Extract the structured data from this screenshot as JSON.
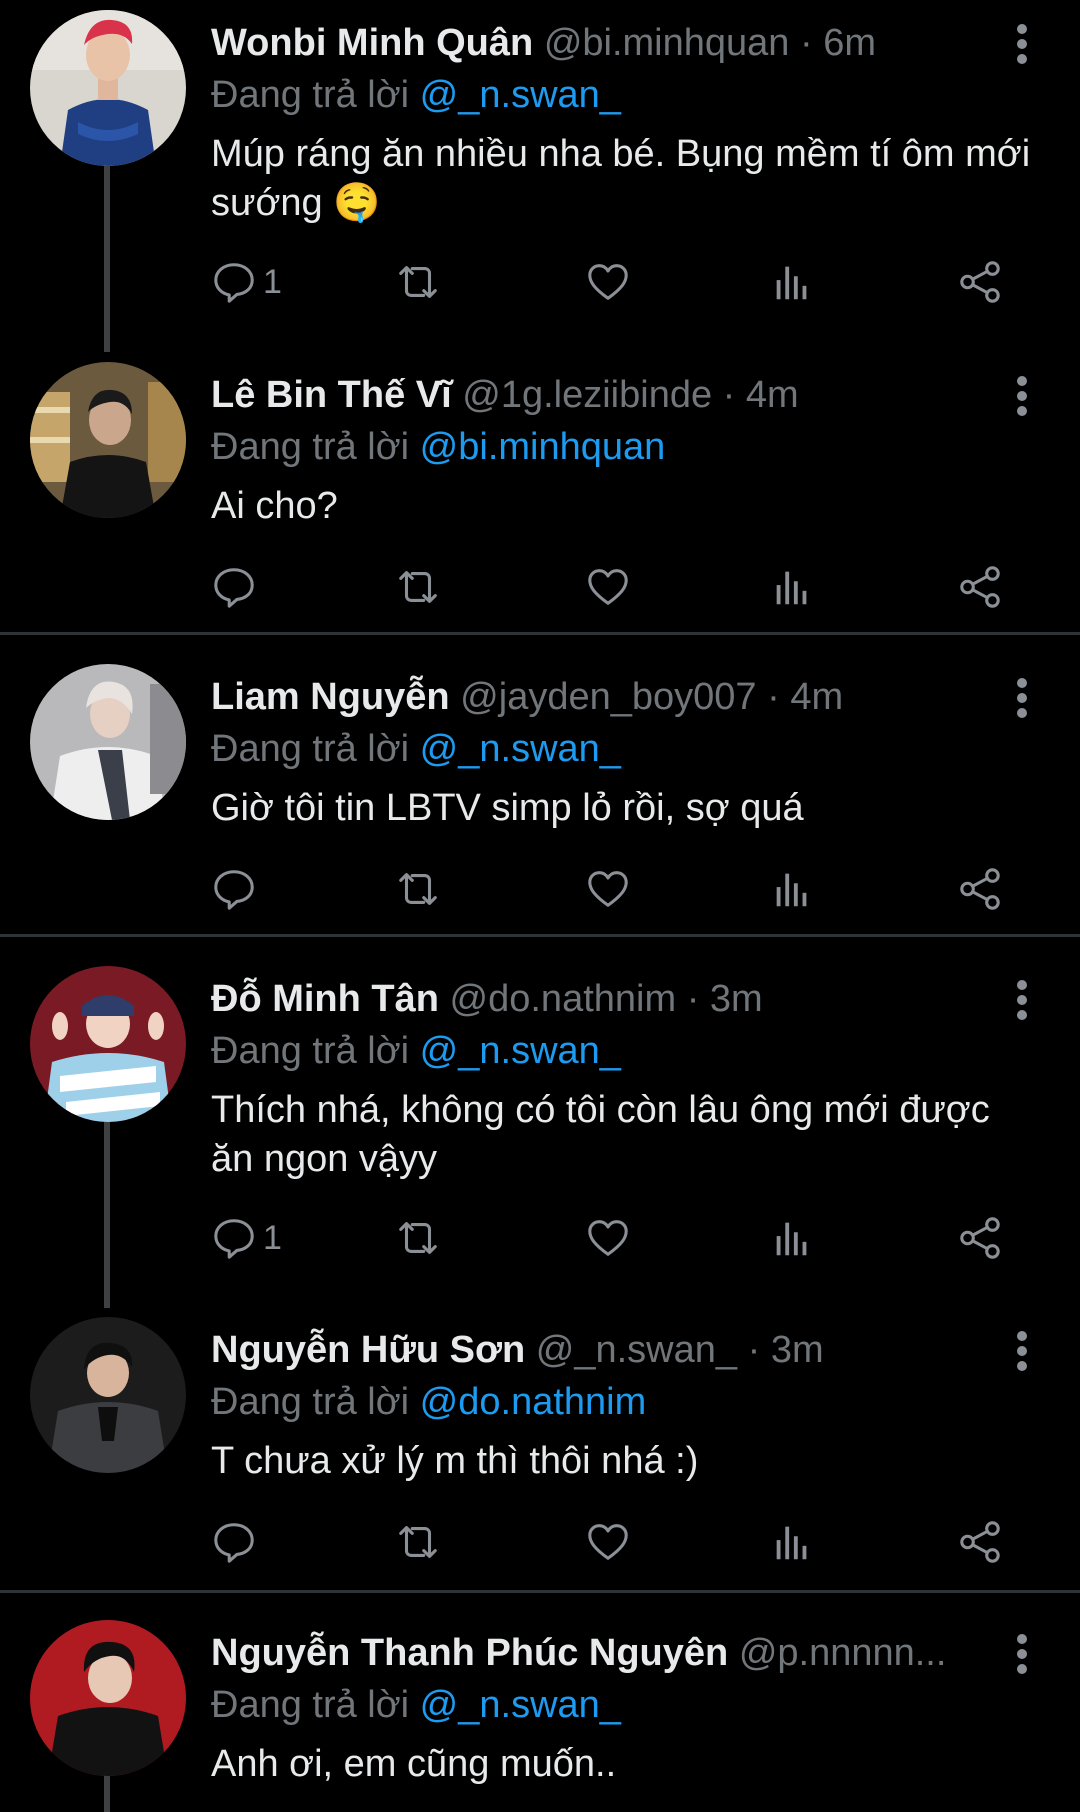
{
  "reply_prefix": "Đang trả lời",
  "colors": {
    "background": "#000000",
    "text": "#e7e9ea",
    "muted": "#71767b",
    "mention": "#1d9bf0",
    "divider": "#2f3336"
  },
  "tweets": [
    {
      "name": "Wonbi Minh Quân",
      "handle": "@bi.minhquan",
      "time": "6m",
      "reply_to": "@_n.swan_",
      "text": "Múp ráng ăn nhiều nha bé. Bụng mềm tí ôm mới sướng 🤤",
      "reply_count": "1"
    },
    {
      "name": "Lê Bin Thế Vĩ",
      "handle": "@1g.leziibinde",
      "time": "4m",
      "reply_to": "@bi.minhquan",
      "text": "Ai cho?",
      "reply_count": ""
    },
    {
      "name": "Liam Nguyễn",
      "handle": "@jayden_boy007",
      "time": "4m",
      "reply_to": "@_n.swan_",
      "text": "Giờ tôi tin LBTV simp lỏ rồi, sợ quá",
      "reply_count": ""
    },
    {
      "name": "Đỗ Minh Tân",
      "handle": "@do.nathnim",
      "time": "3m",
      "reply_to": "@_n.swan_",
      "text": "Thích nhá, không có tôi còn lâu ông mới được ăn ngon vậyy",
      "reply_count": "1"
    },
    {
      "name": "Nguyễn Hữu Sơn",
      "handle": "@_n.swan_",
      "time": "3m",
      "reply_to": "@do.nathnim",
      "text": "T chưa xử lý m thì thôi nhá :)",
      "reply_count": ""
    },
    {
      "name": "Nguyễn Thanh Phúc Nguyên",
      "handle": "@p.nnnnn...",
      "time": "",
      "reply_to": "@_n.swan_",
      "text": "Anh ơi, em cũng muốn..",
      "reply_count": ""
    }
  ]
}
